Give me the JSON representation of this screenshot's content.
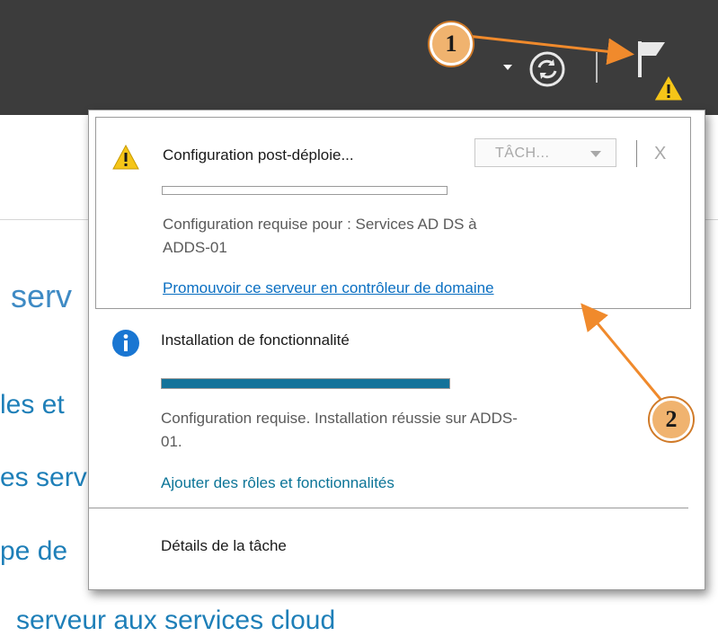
{
  "topbar": {
    "icons": [
      "chevron-down-icon",
      "refresh-icon",
      "flag-icon",
      "warning-icon"
    ]
  },
  "background": {
    "title_fragment": "serv",
    "item1": "les et",
    "item2": "es serv",
    "item3": "pe de",
    "item4": "serveur aux services cloud"
  },
  "notifications": [
    {
      "title": "Configuration post-déploie...",
      "tasks_label": "TÂCH...",
      "close_label": "X",
      "progress": 0,
      "description": "Configuration requise pour : Services AD DS à ADDS-01",
      "link": "Promouvoir ce serveur en contrôleur de domaine"
    },
    {
      "title": "Installation de fonctionnalité",
      "progress": 1.0,
      "description": "Configuration requise. Installation réussie sur ADDS-01.",
      "link": "Ajouter des rôles et fonctionnalités"
    }
  ],
  "details_link": "Détails de la tâche",
  "annotations": {
    "badge1": "1",
    "badge2": "2",
    "color": "#f08a2c"
  }
}
